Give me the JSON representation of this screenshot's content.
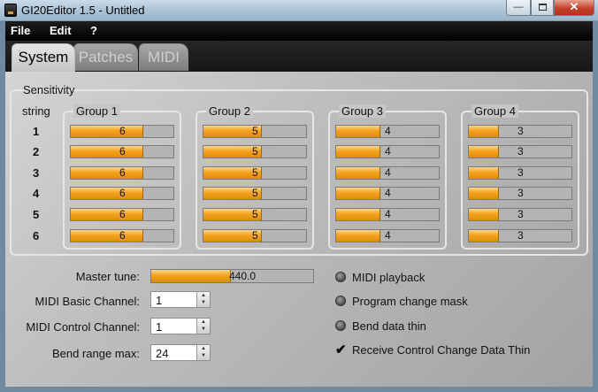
{
  "window": {
    "title": "GI20Editor 1.5 - Untitled"
  },
  "menu": {
    "file": "File",
    "edit": "Edit",
    "help": "?"
  },
  "tabs": {
    "system": "System",
    "patches": "Patches",
    "midi": "MIDI"
  },
  "sensitivity": {
    "title": "Sensitivity",
    "string_header": "string",
    "strings": [
      "1",
      "2",
      "3",
      "4",
      "5",
      "6"
    ],
    "groups": [
      {
        "name": "Group 1",
        "values": [
          "6",
          "6",
          "6",
          "6",
          "6",
          "6"
        ],
        "fill_fraction": 0.71
      },
      {
        "name": "Group 2",
        "values": [
          "5",
          "5",
          "5",
          "5",
          "5",
          "5"
        ],
        "fill_fraction": 0.57
      },
      {
        "name": "Group 3",
        "values": [
          "4",
          "4",
          "4",
          "4",
          "4",
          "4"
        ],
        "fill_fraction": 0.43
      },
      {
        "name": "Group 4",
        "values": [
          "3",
          "3",
          "3",
          "3",
          "3",
          "3"
        ],
        "fill_fraction": 0.29
      }
    ]
  },
  "controls": {
    "master_tune_label": "Master tune:",
    "master_tune_value": "440.0",
    "master_tune_fill_fraction": 0.49,
    "midi_basic_label": "MIDI Basic Channel:",
    "midi_basic_value": "1",
    "midi_control_label": "MIDI Control Channel:",
    "midi_control_value": "1",
    "bend_range_label": "Bend range max:",
    "bend_range_value": "24"
  },
  "options": [
    {
      "label": "MIDI playback",
      "checked": false
    },
    {
      "label": "Program change mask",
      "checked": false
    },
    {
      "label": "Bend data thin",
      "checked": false
    },
    {
      "label": "Receive Control Change Data Thin",
      "checked": true
    }
  ],
  "colors": {
    "slider_fill": "#f4a21d",
    "slider_track": "#b4b4b4",
    "menubar": "#000000"
  }
}
